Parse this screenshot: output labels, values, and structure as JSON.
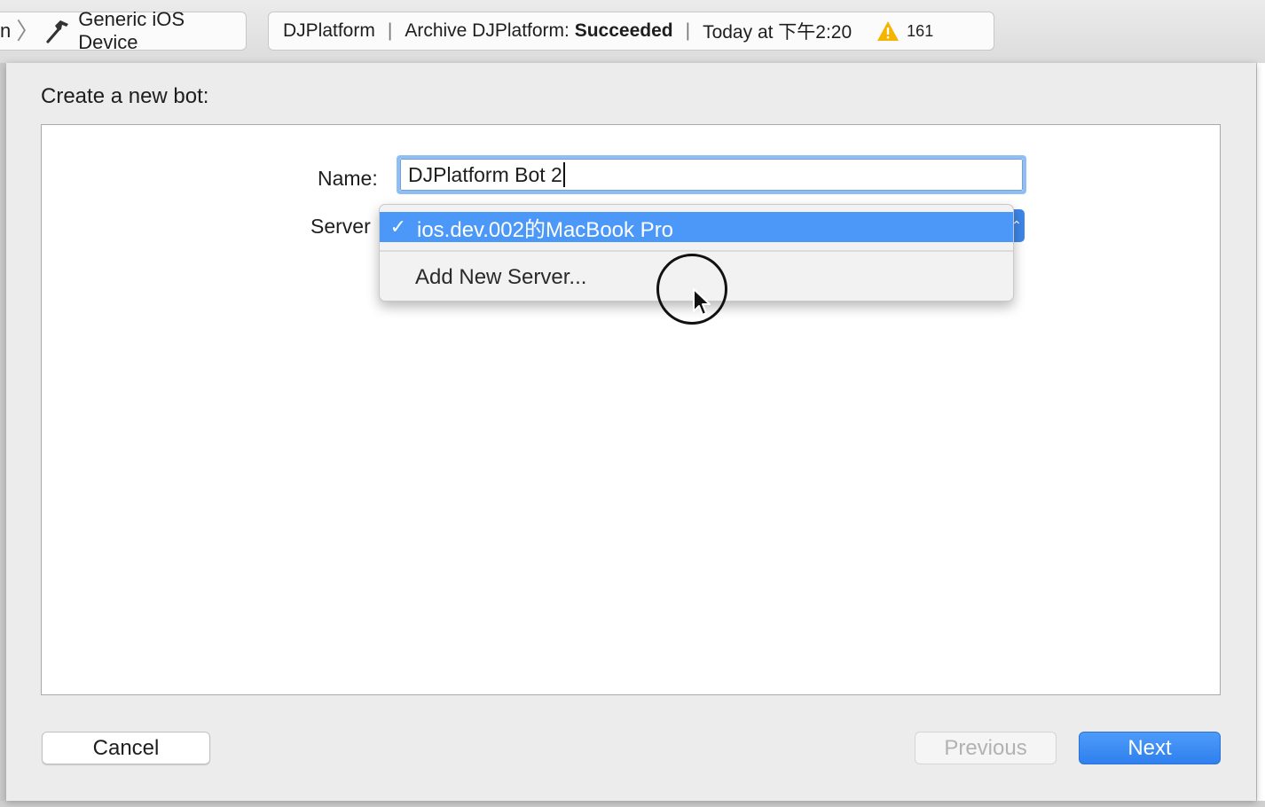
{
  "toolbar": {
    "scheme_fragment": "n",
    "scheme_separator": "〉",
    "device": "Generic iOS Device",
    "icons": [
      "hammer-icon",
      "warning-icon"
    ],
    "activity": {
      "project": "DJPlatform",
      "separator": "|",
      "status_prefix": "Archive DJPlatform: ",
      "status_result": "Succeeded",
      "time": "Today at 下午2:20",
      "warning_count": "161"
    }
  },
  "sheet": {
    "title": "Create a new bot:",
    "name_label": "Name:",
    "name_value": "DJPlatform Bot 2",
    "server_label": "Server",
    "server_menu": {
      "selected_check": "✓",
      "selected": "ios.dev.002的MacBook Pro",
      "options": [
        "Add New Server..."
      ]
    },
    "buttons": {
      "cancel": "Cancel",
      "previous": "Previous",
      "next": "Next"
    }
  },
  "colors": {
    "accent": "#3d86e8",
    "menu_highlight": "#4b98f8",
    "focus_ring": "#8fbef5",
    "warning": "#f5b400"
  }
}
